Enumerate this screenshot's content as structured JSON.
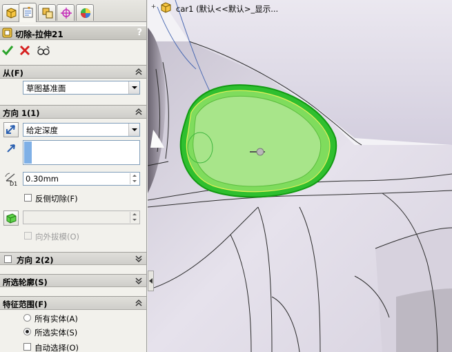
{
  "feature": {
    "title": "切除-拉伸21",
    "help": "?"
  },
  "tabs": [
    {
      "icon": "feature-manager-icon"
    },
    {
      "icon": "property-manager-icon"
    },
    {
      "icon": "configuration-manager-icon"
    },
    {
      "icon": "dimxpert-icon"
    },
    {
      "icon": "display-manager-icon"
    }
  ],
  "actions": {
    "ok_icon": "check-icon",
    "cancel_icon": "close-icon",
    "preview_icon": "detailed-preview-icon"
  },
  "from": {
    "label": "从(F)",
    "value": "草图基准面"
  },
  "direction1": {
    "label": "方向 1(1)",
    "end_condition": "给定深度",
    "depth": "0.30mm",
    "depth_unit_label": "D1",
    "flip_side_label": "反侧切除(F)",
    "draft_outward_label": "向外拔模(O)"
  },
  "direction2": {
    "label": "方向 2(2)"
  },
  "selected_contours": {
    "label": "所选轮廓(S)"
  },
  "feature_scope": {
    "label": "特征范围(F)",
    "options": [
      {
        "label": "所有实体(A)",
        "selected": false
      },
      {
        "label": "所选实体(S)",
        "selected": true
      }
    ],
    "auto_select_label": "自动选择(O)"
  },
  "tree": {
    "root": "car1  (默认<<默认>_显示..."
  },
  "colors": {
    "preview_green": "#36d23a",
    "preview_fill": "#a8e58a",
    "body": "#ddd8e4"
  }
}
